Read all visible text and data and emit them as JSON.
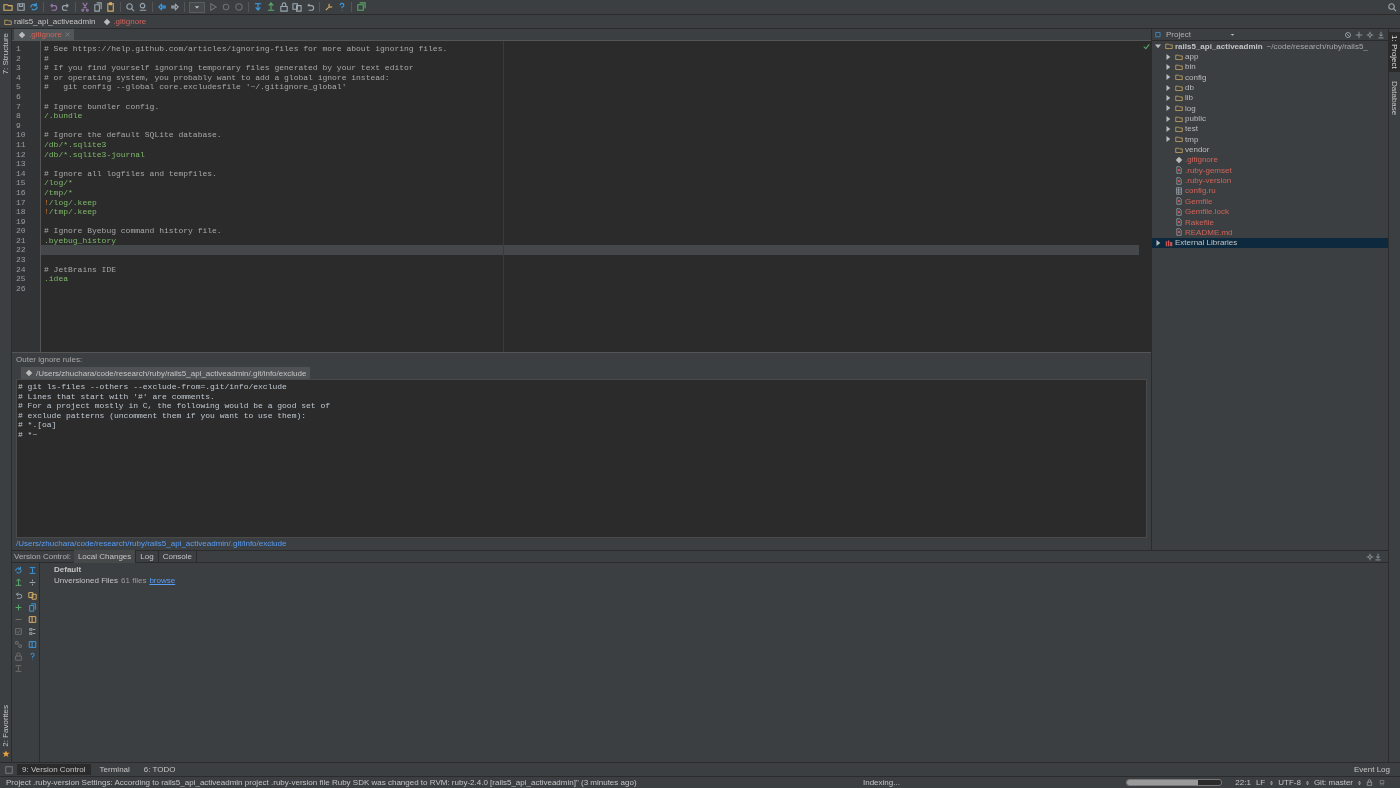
{
  "breadcrumbs": [
    {
      "label": "rails5_api_activeadmin",
      "kind": "folder"
    },
    {
      "label": ".gitignore",
      "kind": "gitignore"
    }
  ],
  "left_strip": {
    "top": [
      {
        "label": "7: Structure",
        "selected": false
      }
    ],
    "bottom": [
      {
        "label": "2: Favorites",
        "selected": false
      }
    ]
  },
  "right_strip": [
    {
      "label": "1: Project",
      "selected": true
    },
    {
      "label": "Database",
      "selected": false
    }
  ],
  "editor": {
    "tabs": [
      {
        "label": ".gitignore",
        "selected": true
      }
    ],
    "lines": [
      {
        "number": "1",
        "kind": "comment",
        "text": "# See https://help.github.com/articles/ignoring-files for more about ignoring files.",
        "current": false
      },
      {
        "number": "2",
        "kind": "comment",
        "text": "#",
        "current": false
      },
      {
        "number": "3",
        "kind": "comment",
        "text": "# If you find yourself ignoring temporary files generated by your text editor",
        "current": false
      },
      {
        "number": "4",
        "kind": "comment",
        "text": "# or operating system, you probably want to add a global ignore instead:",
        "current": false
      },
      {
        "number": "5",
        "kind": "comment",
        "text": "#   git config --global core.excludesfile '~/.gitignore_global'",
        "current": false
      },
      {
        "number": "6",
        "kind": "blank",
        "current": false
      },
      {
        "number": "7",
        "kind": "comment",
        "text": "# Ignore bundler config.",
        "current": false
      },
      {
        "number": "8",
        "kind": "pattern",
        "text": "/.bundle",
        "current": false
      },
      {
        "number": "9",
        "kind": "blank",
        "current": false
      },
      {
        "number": "10",
        "kind": "comment",
        "text": "# Ignore the default SQLite database.",
        "current": false
      },
      {
        "number": "11",
        "kind": "pattern",
        "text": "/db/*.sqlite3",
        "current": false
      },
      {
        "number": "12",
        "kind": "pattern",
        "text": "/db/*.sqlite3-journal",
        "current": false
      },
      {
        "number": "13",
        "kind": "blank",
        "current": false
      },
      {
        "number": "14",
        "kind": "comment",
        "text": "# Ignore all logfiles and tempfiles.",
        "current": false
      },
      {
        "number": "15",
        "kind": "pattern",
        "text": "/log/*",
        "current": false
      },
      {
        "number": "16",
        "kind": "pattern",
        "text": "/tmp/*",
        "current": false
      },
      {
        "number": "17",
        "kind": "negation",
        "text": "!/log/.keep",
        "current": false
      },
      {
        "number": "18",
        "kind": "negation",
        "text": "!/tmp/.keep",
        "current": false
      },
      {
        "number": "19",
        "kind": "blank",
        "current": false
      },
      {
        "number": "20",
        "kind": "comment",
        "text": "# Ignore Byebug command history file.",
        "current": false
      },
      {
        "number": "21",
        "kind": "pattern",
        "text": ".byebug_history",
        "current": false
      },
      {
        "number": "22",
        "kind": "blank",
        "current": true
      },
      {
        "number": "23",
        "kind": "blank",
        "current": false
      },
      {
        "number": "24",
        "kind": "comment",
        "text": "# JetBrains IDE",
        "current": false
      },
      {
        "number": "25",
        "kind": "pattern",
        "text": ".idea",
        "current": false
      },
      {
        "number": "26",
        "kind": "blank",
        "current": false
      }
    ]
  },
  "outer_ignore": {
    "label": "Outer ignore rules:",
    "tabs": [
      {
        "label": "/Users/zhuchara/code/research/ruby/rails5_api_activeadmin/.git/info/exclude",
        "selected": true
      }
    ],
    "lines": [
      "# git ls-files --others --exclude-from=.git/info/exclude",
      "# Lines that start with '#' are comments.",
      "# For a project mostly in C, the following would be a good set of",
      "# exclude patterns (uncomment them if you want to use them):",
      "# *.[oa]",
      "# *~"
    ],
    "link": "/Users/zhuchara/code/research/ruby/rails5_api_activeadmin/.git/info/exclude"
  },
  "project": {
    "title": "Project",
    "tree": [
      {
        "label": "rails5_api_activeadmin",
        "path": "~/code/research/ruby/rails5_",
        "kind": "folder",
        "expanded": true,
        "selected": false,
        "children": [
          {
            "label": "app",
            "kind": "folder",
            "expanded": false,
            "selected": false
          },
          {
            "label": "bin",
            "kind": "folder",
            "expanded": false,
            "selected": false
          },
          {
            "label": "config",
            "kind": "folder",
            "expanded": false,
            "selected": false
          },
          {
            "label": "db",
            "kind": "folder",
            "expanded": false,
            "selected": false
          },
          {
            "label": "lib",
            "kind": "folder",
            "expanded": false,
            "selected": false
          },
          {
            "label": "log",
            "kind": "folder",
            "expanded": false,
            "selected": false
          },
          {
            "label": "public",
            "kind": "folder",
            "expanded": false,
            "selected": false
          },
          {
            "label": "test",
            "kind": "folder",
            "expanded": false,
            "selected": false
          },
          {
            "label": "tmp",
            "kind": "folder",
            "expanded": false,
            "selected": false
          },
          {
            "label": "vendor",
            "kind": "empty-folder",
            "selected": false
          },
          {
            "label": ".gitignore",
            "kind": "gitignore",
            "selected": false
          },
          {
            "label": ".ruby-gemset",
            "kind": "file",
            "selected": false
          },
          {
            "label": ".ruby-version",
            "kind": "file",
            "selected": false
          },
          {
            "label": "config.ru",
            "kind": "table-file",
            "selected": false
          },
          {
            "label": "Gemfile",
            "kind": "file",
            "selected": false
          },
          {
            "label": "Gemfile.lock",
            "kind": "file",
            "selected": false
          },
          {
            "label": "Rakefile",
            "kind": "file",
            "selected": false
          },
          {
            "label": "README.md",
            "kind": "file",
            "selected": false
          }
        ]
      },
      {
        "label": "External Libraries",
        "kind": "library",
        "expanded": false,
        "selected": true
      }
    ]
  },
  "version_control": {
    "label": "Version Control:",
    "tabs": [
      {
        "label": "Local Changes",
        "selected": true
      },
      {
        "label": "Log",
        "selected": false
      },
      {
        "label": "Console",
        "selected": false
      }
    ],
    "changelist": "Default",
    "unversioned": "Unversioned Files",
    "count": "61 files",
    "link": "browse"
  },
  "tool_tabs": [
    {
      "label": "9: Version Control",
      "selected": true
    },
    {
      "label": "Terminal",
      "selected": false
    },
    {
      "label": "6: TODO",
      "selected": false
    }
  ],
  "event_log": "Event Log",
  "status_bar": {
    "message": "Project .ruby-version Settings: According to rails5_api_activeadmin project .ruby-version file Ruby SDK was changed to RVM: ruby-2.4.0 [rails5_api_activeadmin]\" (3 minutes ago)",
    "task": "Indexing...",
    "level": 0.75,
    "position": "22:1",
    "line_separator": "LF",
    "encoding": "UTF-8",
    "branch": "Git: master"
  }
}
